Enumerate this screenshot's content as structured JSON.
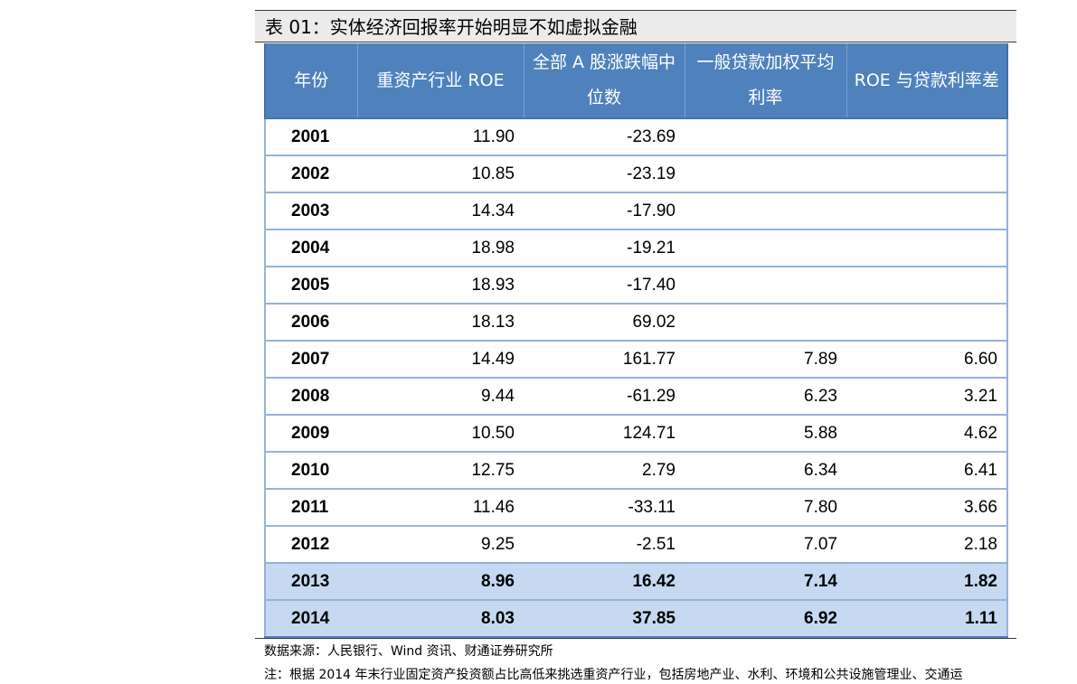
{
  "title": "表 01：实体经济回报率开始明显不如虚拟金融",
  "table": {
    "headers": [
      "年份",
      "重资产行业 ROE",
      "全部 A 股涨跌幅中位数",
      "一般贷款加权平均利率",
      "ROE 与贷款利率差"
    ],
    "rows": [
      {
        "year": "2001",
        "roe": "11.90",
        "median": "-23.69",
        "rate": "",
        "spread": ""
      },
      {
        "year": "2002",
        "roe": "10.85",
        "median": "-23.19",
        "rate": "",
        "spread": ""
      },
      {
        "year": "2003",
        "roe": "14.34",
        "median": "-17.90",
        "rate": "",
        "spread": ""
      },
      {
        "year": "2004",
        "roe": "18.98",
        "median": "-19.21",
        "rate": "",
        "spread": ""
      },
      {
        "year": "2005",
        "roe": "18.93",
        "median": "-17.40",
        "rate": "",
        "spread": ""
      },
      {
        "year": "2006",
        "roe": "18.13",
        "median": "69.02",
        "rate": "",
        "spread": ""
      },
      {
        "year": "2007",
        "roe": "14.49",
        "median": "161.77",
        "rate": "7.89",
        "spread": "6.60"
      },
      {
        "year": "2008",
        "roe": "9.44",
        "median": "-61.29",
        "rate": "6.23",
        "spread": "3.21"
      },
      {
        "year": "2009",
        "roe": "10.50",
        "median": "124.71",
        "rate": "5.88",
        "spread": "4.62"
      },
      {
        "year": "2010",
        "roe": "12.75",
        "median": "2.79",
        "rate": "6.34",
        "spread": "6.41"
      },
      {
        "year": "2011",
        "roe": "11.46",
        "median": "-33.11",
        "rate": "7.80",
        "spread": "3.66"
      },
      {
        "year": "2012",
        "roe": "9.25",
        "median": "-2.51",
        "rate": "7.07",
        "spread": "2.18"
      },
      {
        "year": "2013",
        "roe": "8.96",
        "median": "16.42",
        "rate": "7.14",
        "spread": "1.82"
      },
      {
        "year": "2014",
        "roe": "8.03",
        "median": "37.85",
        "rate": "6.92",
        "spread": "1.11"
      }
    ]
  },
  "source": "数据来源：人民银行、Wind 资讯、财通证券研究所",
  "note": "注：根据 2014 年末行业固定资产投资额占比高低来挑选重资产行业，包括房地产业、水利、环境和公共设施管理业、交通运",
  "colors": {
    "header_bg": "#4f81bd",
    "highlight_bg": "#c6d9f1",
    "row_rule": "#95b3d7"
  }
}
